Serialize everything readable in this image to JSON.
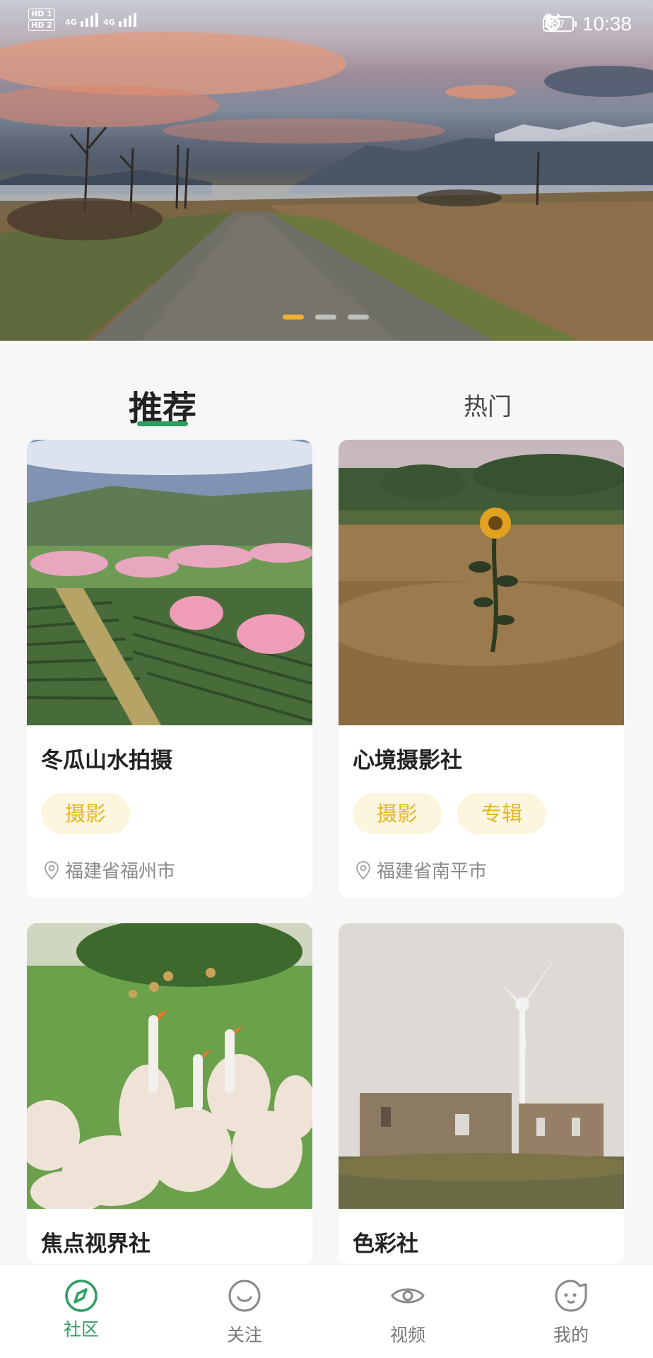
{
  "status_bar": {
    "sim1": "HD 1",
    "sim2": "HD 2",
    "network1": "4G",
    "network2": "4G",
    "battery": "87",
    "time": "10:38"
  },
  "banner": {
    "slide_count": 3,
    "active_slide": 1
  },
  "tabs": [
    {
      "label": "推荐",
      "active": true
    },
    {
      "label": "热门",
      "active": false
    }
  ],
  "cards": [
    {
      "title": "冬瓜山水拍摄",
      "tags": [
        "摄影"
      ],
      "location": "福建省福州市"
    },
    {
      "title": "心境摄影社",
      "tags": [
        "摄影",
        "专辑"
      ],
      "location": "福建省南平市"
    },
    {
      "title": "焦点视界社",
      "tags": [],
      "location": ""
    },
    {
      "title": "色彩社",
      "tags": [],
      "location": ""
    }
  ],
  "bottom_nav": [
    {
      "label": "社区",
      "icon": "compass-icon",
      "active": true
    },
    {
      "label": "关注",
      "icon": "smile-icon",
      "active": false
    },
    {
      "label": "视频",
      "icon": "eye-icon",
      "active": false
    },
    {
      "label": "我的",
      "icon": "face-icon",
      "active": false
    }
  ],
  "colors": {
    "accent_green": "#2f9e62",
    "tag_text": "#e4b52b",
    "tag_bg": "#fdf6de",
    "carousel_active_dot": "#f0b030"
  }
}
